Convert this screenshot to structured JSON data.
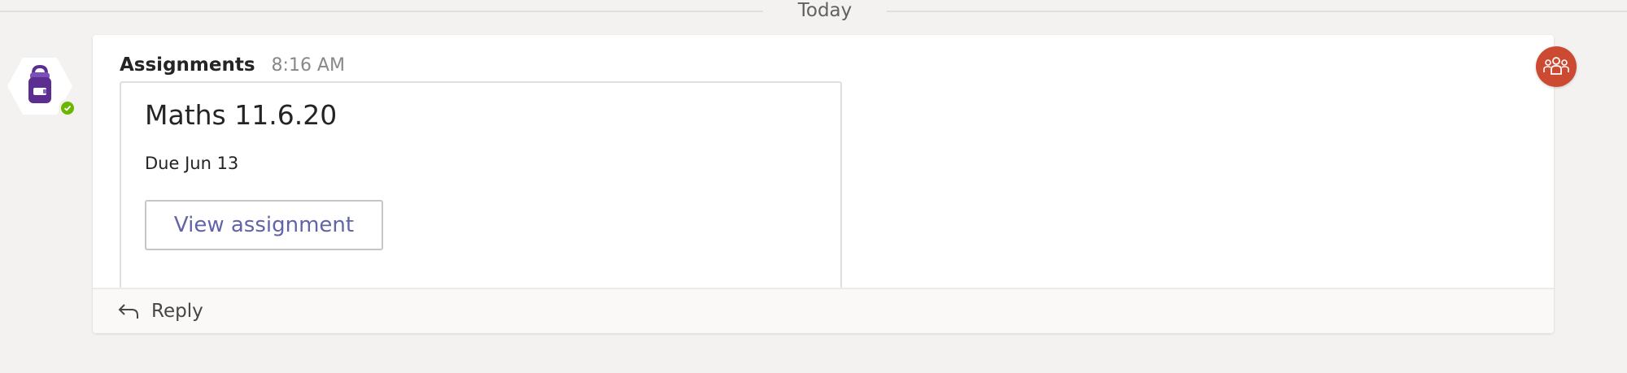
{
  "divider": {
    "label": "Today"
  },
  "message": {
    "author": "Assignments",
    "time": "8:16 AM",
    "avatar_icon": "backpack-icon",
    "presence_status": "available",
    "card": {
      "title": "Maths 11.6.20",
      "due": "Due Jun 13",
      "button_label": "View assignment"
    },
    "reply_label": "Reply",
    "reply_icon": "reply-arrow-icon"
  },
  "team_badge": {
    "icon": "team-people-icon"
  },
  "colors": {
    "background": "#f3f2f1",
    "accent": "#6264a7",
    "avatar_purple": "#5c2e91",
    "presence_green": "#6bb700",
    "team_badge": "#cc4a31"
  }
}
